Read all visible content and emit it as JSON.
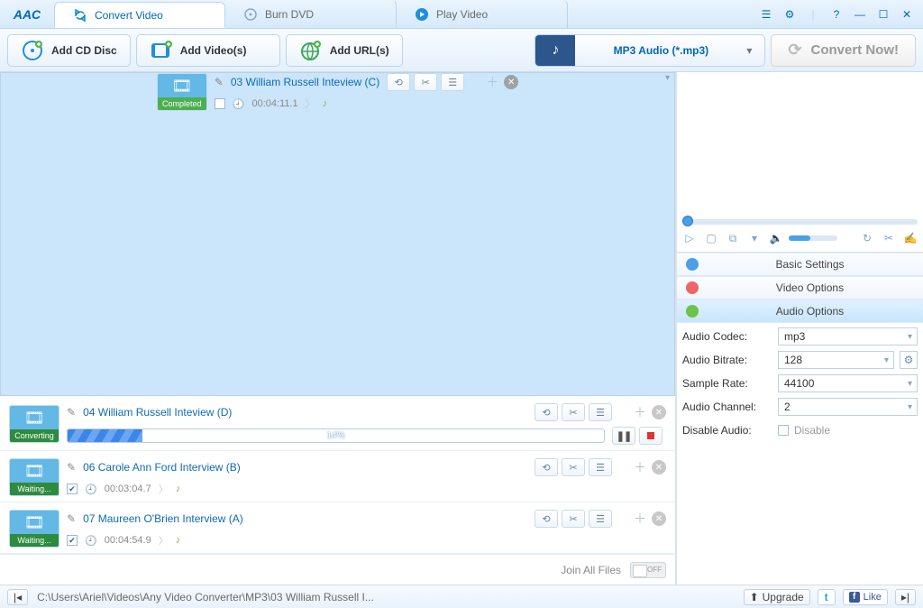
{
  "logo": "AAC",
  "tabs": [
    {
      "label": "Convert Video",
      "active": true
    },
    {
      "label": "Burn DVD",
      "active": false
    },
    {
      "label": "Play Video",
      "active": false
    }
  ],
  "toolbar": {
    "add_cd": "Add CD Disc",
    "add_videos": "Add Video(s)",
    "add_urls": "Add URL(s)",
    "format": "MP3 Audio (*.mp3)",
    "convert": "Convert Now!"
  },
  "files": [
    {
      "title": "03 William Russell Inteview (C)",
      "status_label": "Completed",
      "status_kind": "completed",
      "duration": "00:04:11.1",
      "checked": false,
      "selected": true,
      "show_meta": true
    },
    {
      "title": "04 William Russell Inteview (D)",
      "status_label": "Converting",
      "status_kind": "converting",
      "selected": false,
      "show_meta": false,
      "progress_pct": 14,
      "progress_label": "14%"
    },
    {
      "title": "06 Carole Ann Ford Interview (B)",
      "status_label": "Waiting...",
      "status_kind": "waiting",
      "duration": "00:03:04.7",
      "checked": true,
      "selected": false,
      "show_meta": true
    },
    {
      "title": "07 Maureen O'Brien Interview (A)",
      "status_label": "Waiting...",
      "status_kind": "waiting",
      "duration": "00:04:54.9",
      "checked": true,
      "selected": false,
      "show_meta": true
    }
  ],
  "list_footer": {
    "join": "Join All Files"
  },
  "right": {
    "sections": {
      "basic": "Basic Settings",
      "video": "Video Options",
      "audio": "Audio Options"
    },
    "audio": {
      "codec_label": "Audio Codec:",
      "codec_value": "mp3",
      "bitrate_label": "Audio Bitrate:",
      "bitrate_value": "128",
      "samplerate_label": "Sample Rate:",
      "samplerate_value": "44100",
      "channel_label": "Audio Channel:",
      "channel_value": "2",
      "disable_label": "Disable Audio:",
      "disable_value": "Disable"
    }
  },
  "statusbar": {
    "path": "C:\\Users\\Ariel\\Videos\\Any Video Converter\\MP3\\03 William Russell I...",
    "upgrade": "Upgrade",
    "like": "Like"
  }
}
